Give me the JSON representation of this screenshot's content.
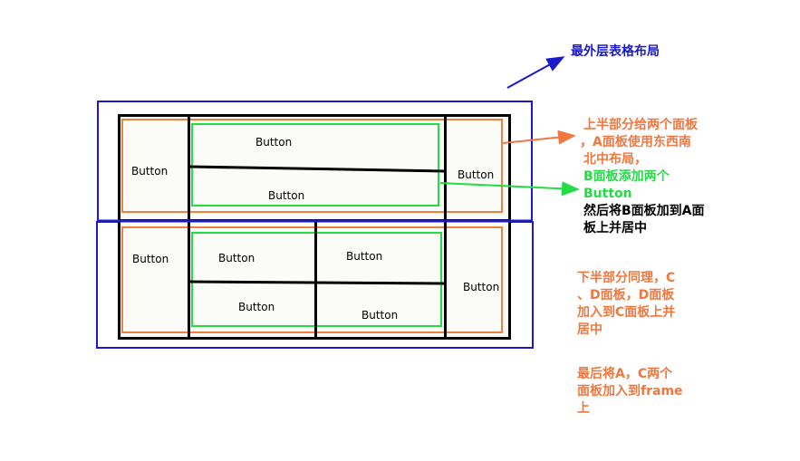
{
  "title": "最外层表格布局",
  "top": {
    "west_button": "Button",
    "east_button": "Button",
    "b_north_button": "Button",
    "b_south_button": "Button"
  },
  "bottom": {
    "west_button": "Button",
    "east_button": "Button",
    "d_button_1": "Button",
    "d_button_2": "Button",
    "d_button_3": "Button",
    "d_button_4": "Button"
  },
  "notes": {
    "top_half_line1": "上半部分给两个面板",
    "top_half_line2": "，A面板使用东西南",
    "top_half_line3": "北中布局，",
    "b_panel_line1": "B面板添加两个",
    "b_panel_line2": "Button",
    "then_line1": "然后将B面板加到A面",
    "then_line2": "板上并居中",
    "bottom_line1": "下半部分同理，C",
    "bottom_line2": "、D面板，D面板",
    "bottom_line3": "加入到C面板上并",
    "bottom_line4": "居中",
    "final_line1": "最后将A，C两个",
    "final_line2": "面板加入到frame",
    "final_line3": "上"
  },
  "colors": {
    "outer_border": "#1a1acc",
    "panel_a_c": "#f08040",
    "panel_b_d": "#22dd44",
    "dark_border": "#000000",
    "note_orange": "#f07840",
    "note_green": "#22dd44"
  }
}
